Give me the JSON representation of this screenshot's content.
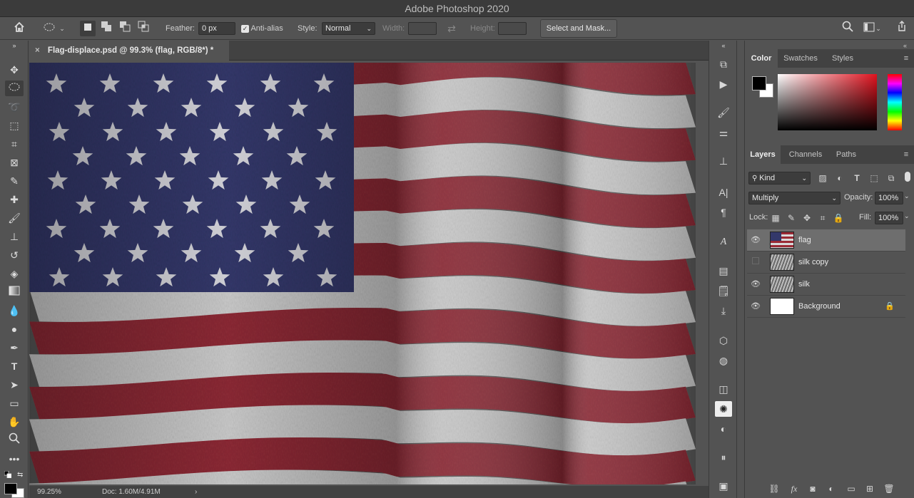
{
  "app_title": "Adobe Photoshop 2020",
  "options": {
    "feather_label": "Feather:",
    "feather_value": "0 px",
    "antialias_label": "Anti-alias",
    "style_label": "Style:",
    "style_value": "Normal",
    "width_label": "Width:",
    "height_label": "Height:",
    "select_mask_label": "Select and Mask..."
  },
  "document": {
    "tab_title": "Flag-displace.psd @ 99.3% (flag, RGB/8*) *",
    "zoom": "99.25%",
    "doc_size": "Doc: 1.60M/4.91M"
  },
  "color_panel": {
    "tabs": [
      "Color",
      "Swatches",
      "Styles"
    ],
    "foreground": "#000000",
    "background": "#ffffff"
  },
  "layers_panel": {
    "tabs": [
      "Layers",
      "Channels",
      "Paths"
    ],
    "filter_kind": "Kind",
    "blend_mode": "Multiply",
    "opacity_label": "Opacity:",
    "opacity_value": "100%",
    "lock_label": "Lock:",
    "fill_label": "Fill:",
    "fill_value": "100%",
    "layers": [
      {
        "name": "flag",
        "visible": true,
        "selected": true
      },
      {
        "name": "silk copy",
        "visible": false,
        "selected": false
      },
      {
        "name": "silk",
        "visible": true,
        "selected": false
      },
      {
        "name": "Background",
        "visible": true,
        "selected": false,
        "locked": true
      }
    ]
  },
  "colors": {
    "flag_red": "#8c2a35",
    "flag_white": "#c9c9c9",
    "flag_blue": "#33386a"
  }
}
